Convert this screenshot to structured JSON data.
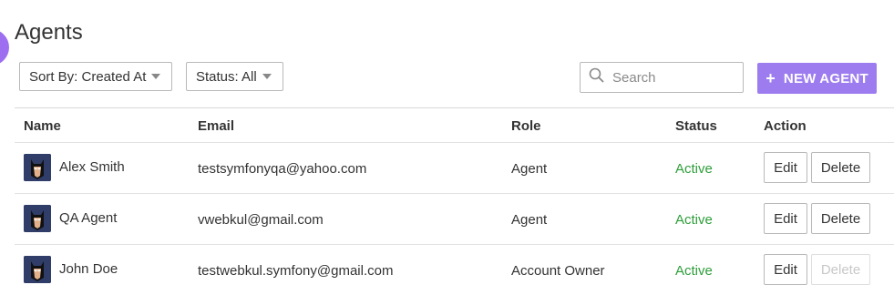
{
  "page": {
    "title": "Agents"
  },
  "toolbar": {
    "sort_label": "Sort By: Created At",
    "status_label": "Status: All",
    "search_placeholder": "Search",
    "search_value": "",
    "new_agent_label": "NEW AGENT"
  },
  "table": {
    "headers": {
      "name": "Name",
      "email": "Email",
      "role": "Role",
      "status": "Status",
      "action": "Action"
    },
    "rows": [
      {
        "name": "Alex Smith",
        "email": "testsymfonyqa@yahoo.com",
        "role": "Agent",
        "status": "Active",
        "edit": "Edit",
        "delete": "Delete",
        "delete_disabled": false
      },
      {
        "name": "QA Agent",
        "email": "vwebkul@gmail.com",
        "role": "Agent",
        "status": "Active",
        "edit": "Edit",
        "delete": "Delete",
        "delete_disabled": false
      },
      {
        "name": "John Doe",
        "email": "testwebkul.symfony@gmail.com",
        "role": "Account Owner",
        "status": "Active",
        "edit": "Edit",
        "delete": "Delete",
        "delete_disabled": true
      }
    ]
  },
  "colors": {
    "accent": "#9d7cf0",
    "status_active": "#2e9e3a"
  },
  "icons": {
    "search": "search-icon",
    "plus": "plus-icon",
    "caret": "caret-down-icon",
    "avatar": "avatar-icon"
  }
}
